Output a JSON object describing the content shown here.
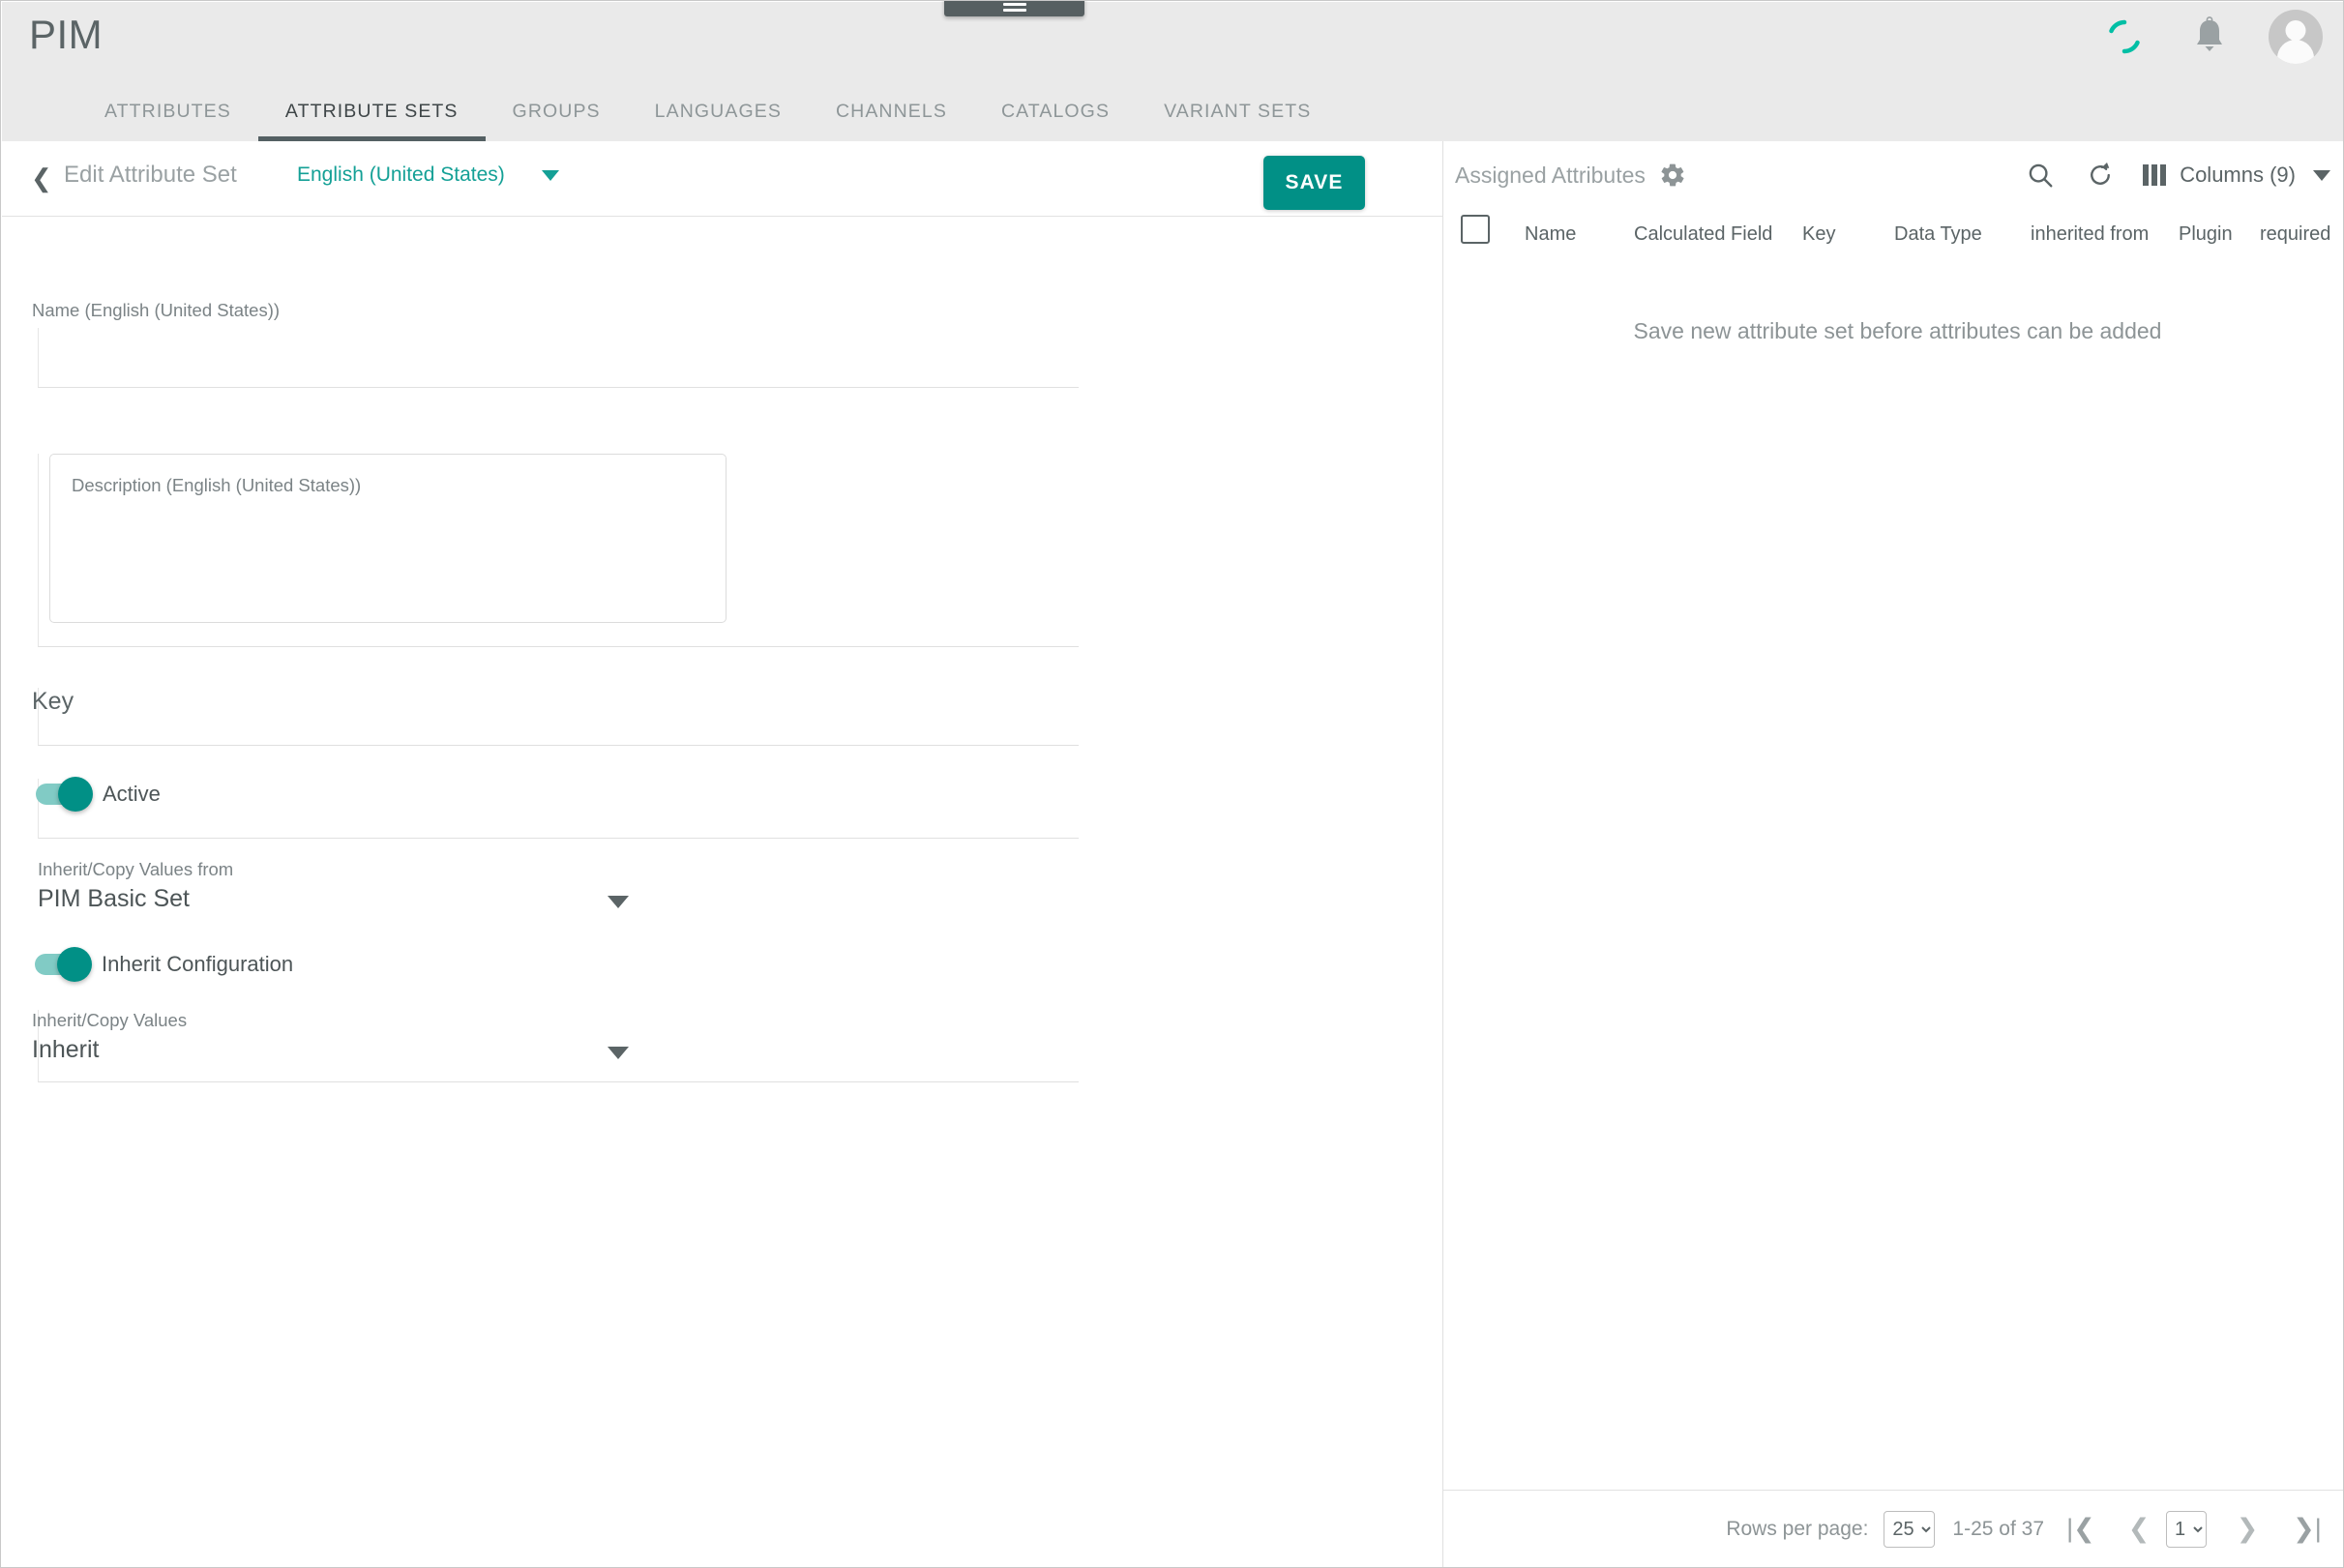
{
  "app": {
    "brand": "PIM",
    "menu_icon": "hamburger-icon"
  },
  "topbar": {
    "icons": [
      {
        "name": "sync-spinner-icon",
        "color": "#00bfa5"
      },
      {
        "name": "notifications-bell-icon",
        "color": "#9aa1a3"
      },
      {
        "name": "user-avatar",
        "color": "#c7c7c7"
      }
    ]
  },
  "nav": {
    "tabs": [
      {
        "label": "ATTRIBUTES",
        "active": false
      },
      {
        "label": "ATTRIBUTE SETS",
        "active": true
      },
      {
        "label": "GROUPS",
        "active": false
      },
      {
        "label": "LANGUAGES",
        "active": false
      },
      {
        "label": "CHANNELS",
        "active": false
      },
      {
        "label": "CATALOGS",
        "active": false
      },
      {
        "label": "VARIANT SETS",
        "active": false
      }
    ]
  },
  "left": {
    "back_icon": "chevron-left-icon",
    "title": "Edit Attribute Set",
    "language": "English (United States)",
    "save_label": "SAVE",
    "form": {
      "name_label": "Name (English (United States))",
      "name_value": "",
      "description_label": "Description (English (United States))",
      "description_value": "",
      "key_label": "Key",
      "key_value": "",
      "active_label": "Active",
      "active_on": true,
      "inherit_from_label": "Inherit/Copy Values from",
      "inherit_from_value": "PIM Basic Set",
      "inherit_config_label": "Inherit Configuration",
      "inherit_config_on": true,
      "inherit_values_label": "Inherit/Copy Values",
      "inherit_values_value": "Inherit"
    }
  },
  "right": {
    "title": "Assigned Attributes",
    "settings_icon": "gear-icon",
    "search_icon": "search-icon",
    "refresh_icon": "refresh-icon",
    "columns_icon": "columns-icon",
    "columns_label": "Columns (9)",
    "table": {
      "columns": [
        "Name",
        "Calculated Field",
        "Key",
        "Data Type",
        "inherited from",
        "Plugin",
        "required"
      ],
      "empty_message": "Save new attribute set before attributes can be added",
      "rows": []
    },
    "paginator": {
      "rows_per_page_label": "Rows per page:",
      "rows_per_page_value": "25",
      "rows_per_page_options": [
        "25"
      ],
      "range_text": "1-25 of 37",
      "page_value": "1",
      "page_options": [
        "1"
      ],
      "first_icon": "first-page-icon",
      "prev_icon": "previous-page-icon",
      "next_icon": "next-page-icon",
      "last_icon": "last-page-icon"
    }
  },
  "colors": {
    "accent_teal": "#019086",
    "spinner_teal": "#00bfa5",
    "header_bg": "#eaeaea",
    "tab_indicator": "#546063",
    "text_muted": "#9aa1a3"
  }
}
